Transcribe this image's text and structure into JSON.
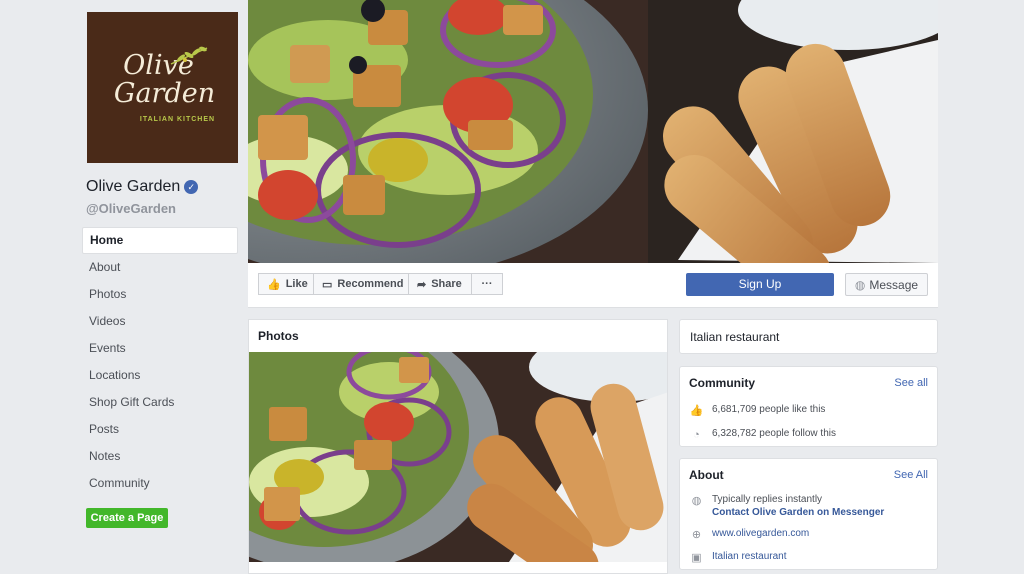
{
  "brand": {
    "logo_line1": "Olive",
    "logo_line2": "Garden",
    "logo_sub": "ITALIAN KITCHEN",
    "logo_color": "#4a2a18"
  },
  "page": {
    "name": "Olive Garden",
    "handle": "@OliveGarden",
    "verified_icon": "check-icon"
  },
  "nav": {
    "items": [
      {
        "label": "Home"
      },
      {
        "label": "About"
      },
      {
        "label": "Photos"
      },
      {
        "label": "Videos"
      },
      {
        "label": "Events"
      },
      {
        "label": "Locations"
      },
      {
        "label": "Shop Gift Cards"
      },
      {
        "label": "Posts"
      },
      {
        "label": "Notes"
      },
      {
        "label": "Community"
      }
    ],
    "create_page": "Create a Page"
  },
  "actions": {
    "like": "Like",
    "recommend": "Recommend",
    "share": "Share",
    "more": "···",
    "sign_up": "Sign Up",
    "message": "Message"
  },
  "photos": {
    "title": "Photos"
  },
  "category": "Italian restaurant",
  "community": {
    "title": "Community",
    "see_all": "See all",
    "likes": "6,681,709 people like this",
    "follows": "6,328,782 people follow this"
  },
  "about": {
    "title": "About",
    "see_all": "See All",
    "replies": "Typically replies instantly",
    "contact": "Contact Olive Garden on Messenger",
    "website": "www.olivegarden.com",
    "category": "Italian restaurant"
  },
  "colors": {
    "accent": "#4267b2",
    "green": "#42b72a",
    "background": "#e9ebee"
  }
}
